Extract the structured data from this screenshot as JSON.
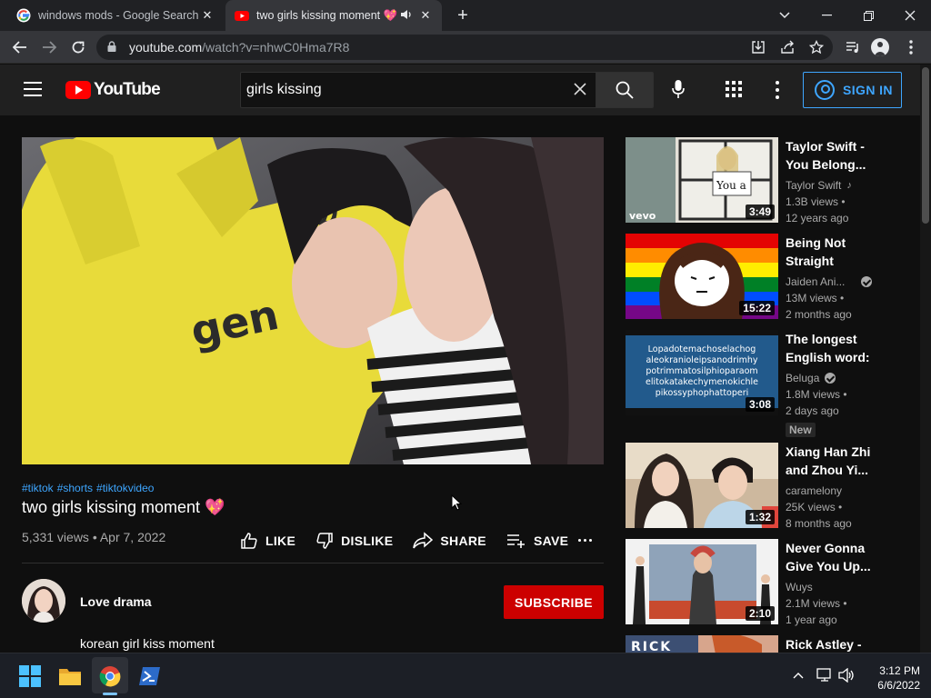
{
  "browser": {
    "tabs": [
      {
        "title": "windows mods - Google Search",
        "icon": "google-icon"
      },
      {
        "title": "two girls kissing moment 💖",
        "icon": "youtube-icon",
        "audio_icon": "speaker-icon"
      }
    ],
    "address_host": "youtube.com",
    "address_path": "/watch?v=nhwC0Hma7R8"
  },
  "youtube": {
    "logo_text": "YouTube",
    "search_value": "girls kissing",
    "sign_in_label": "SIGN IN",
    "video": {
      "hashtags": [
        "#tiktok",
        "#shorts",
        "#tiktokvideo"
      ],
      "title": "two girls kissing moment 💖",
      "stats": "5,331 views • Apr 7, 2022",
      "like_label": "LIKE",
      "dislike_label": "DISLIKE",
      "share_label": "SHARE",
      "save_label": "SAVE",
      "channel_name": "Love drama",
      "subscribe_label": "SUBSCRIBE",
      "description": "korean girl kiss moment"
    },
    "recommendations": [
      {
        "title": "Taylor Swift - You Belong...",
        "channel": "Taylor Swift",
        "channel_badge": "music-note-icon",
        "views": "1.3B views •",
        "age": "12 years ago",
        "duration": "3:49"
      },
      {
        "title": "Being Not Straight",
        "channel": "Jaiden Ani...",
        "channel_badge": "verified-icon",
        "views": "13M views •",
        "age": "2 months ago",
        "duration": "15:22"
      },
      {
        "title": "The longest English word:",
        "channel": "Beluga",
        "channel_badge": "verified-icon",
        "views": "1.8M views •",
        "age": "2 days ago",
        "duration": "3:08",
        "badge": "New",
        "thumb_text": [
          "Lopadotemachoselachog",
          "aleokranioleipsanodrimhy",
          "potrimmatosilphioparaom",
          "elitokatakechymenokichle",
          "pikossyphophattoperi"
        ]
      },
      {
        "title": "Xiang Han Zhi and Zhou Yi...",
        "channel": "caramelony",
        "views": "25K views •",
        "age": "8 months ago",
        "duration": "1:32"
      },
      {
        "title": "Never Gonna Give You Up...",
        "channel": "Wuys",
        "views": "2.1M views •",
        "age": "1 year ago",
        "duration": "2:10"
      },
      {
        "title": "Rick Astley -",
        "thumb_text": "RICK"
      }
    ],
    "vevo_watermark": "vevo"
  },
  "taskbar": {
    "time": "3:12 PM",
    "date": "6/6/2022"
  }
}
